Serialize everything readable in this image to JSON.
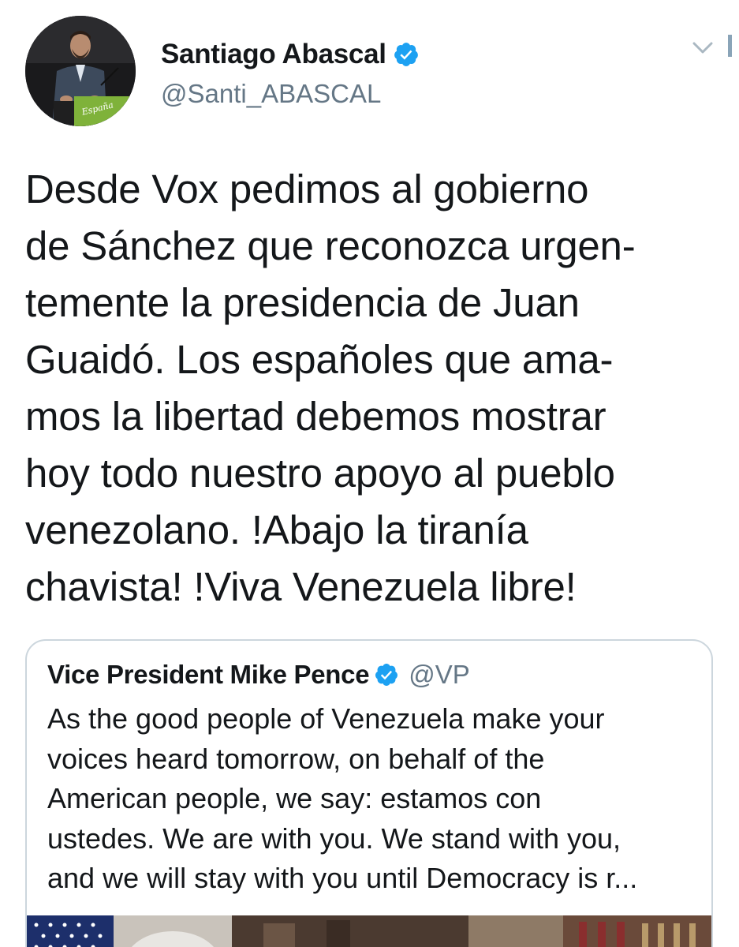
{
  "author": {
    "display_name": "Santiago Abascal",
    "handle": "@Santi_ABASCAL",
    "verified_icon": "verified-badge-icon",
    "avatar_sign_text": "España"
  },
  "tweet": {
    "text": "Desde Vox pedimos al gobierno\nde Sánchez que reconozca urgen-\ntemente la presidencia de Juan\nGuaidó. Los españoles que ama-\nmos la libertad debemos mostrar\nhoy todo nuestro apoyo al pueblo\nvenezolano. !Abajo la tiranía\nchavista! !Viva Venezuela libre!"
  },
  "quoted_tweet": {
    "display_name": "Vice President Mike Pence",
    "handle": "@VP",
    "text": "As the good people of Venezuela make your\nvoices heard tomorrow, on behalf of the\nAmerican people, we say: estamos con\nustedes. We are with you. We stand with you,\nand we will stay with you until Democracy is r..."
  },
  "colors": {
    "text_primary": "#14171a",
    "text_secondary": "#657786",
    "verified_blue": "#1da1f2",
    "border": "#ccd6dd",
    "chevron": "#aab8c2"
  }
}
